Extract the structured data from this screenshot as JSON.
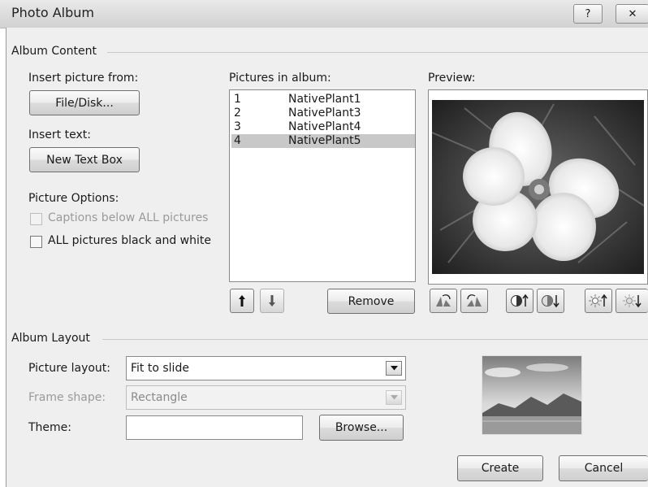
{
  "window": {
    "title": "Photo Album",
    "help_label": "?",
    "close_label": "✕"
  },
  "album_content": {
    "group_title": "Album Content",
    "insert_picture_label": "Insert picture from:",
    "file_disk_button": "File/Disk...",
    "insert_text_label": "Insert text:",
    "new_text_box_button": "New Text Box",
    "picture_options_label": "Picture Options:",
    "captions_checkbox": {
      "label": "Captions below ALL pictures",
      "checked": false,
      "enabled": false
    },
    "bw_checkbox": {
      "label": "ALL pictures black and white",
      "checked": false,
      "enabled": true
    },
    "pictures_label": "Pictures in album:",
    "pictures": [
      {
        "num": "1",
        "name": "NativePlant1",
        "selected": false
      },
      {
        "num": "2",
        "name": "NativePlant3",
        "selected": false
      },
      {
        "num": "3",
        "name": "NativePlant4",
        "selected": false
      },
      {
        "num": "4",
        "name": "NativePlant5",
        "selected": true
      }
    ],
    "move_up_icon": "arrow-up-icon",
    "move_down_icon": "arrow-down-icon",
    "remove_button": "Remove",
    "preview_label": "Preview:",
    "preview_tools": [
      "rotate-left-icon",
      "rotate-right-icon",
      "contrast-up-icon",
      "contrast-down-icon",
      "brightness-up-icon",
      "brightness-down-icon"
    ]
  },
  "album_layout": {
    "group_title": "Album Layout",
    "picture_layout_label": "Picture layout:",
    "picture_layout_value": "Fit to slide",
    "frame_shape_label": "Frame shape:",
    "frame_shape_value": "Rectangle",
    "theme_label": "Theme:",
    "theme_value": "",
    "browse_button": "Browse..."
  },
  "footer": {
    "create_button": "Create",
    "cancel_button": "Cancel"
  }
}
